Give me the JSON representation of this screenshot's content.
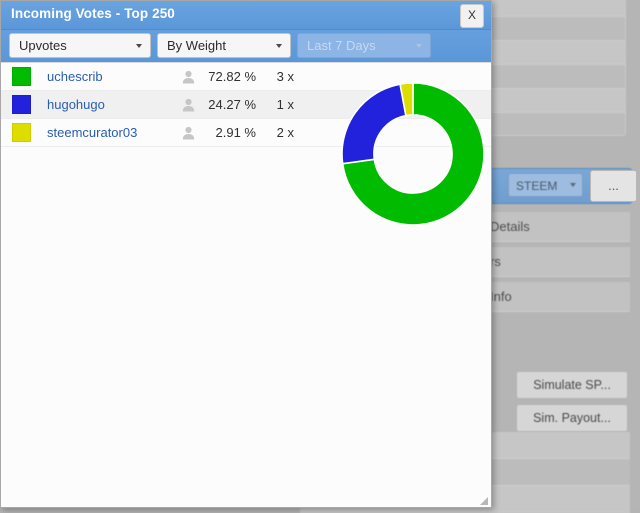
{
  "background": {
    "toolbar": {
      "steem_select_label": "STEEM",
      "more_button_label": "..."
    },
    "menu_items": [
      {
        "label": "Details"
      },
      {
        "label": "rs"
      },
      {
        "label": "Info"
      }
    ],
    "buttons": [
      {
        "label": "Simulate SP..."
      },
      {
        "label": "Sim. Payout..."
      }
    ]
  },
  "dialog": {
    "title": "Incoming Votes - Top 250",
    "close_label": "X",
    "toolbar": {
      "vote_type": {
        "value": "Upvotes",
        "disabled": false
      },
      "sort_by": {
        "value": "By Weight",
        "disabled": false
      },
      "period": {
        "value": "Last 7 Days",
        "disabled": true
      }
    },
    "rows": [
      {
        "color": "#00bb00",
        "name": "uchescrib",
        "percent": "72.82 %",
        "count": "3 x"
      },
      {
        "color": "#2222dd",
        "name": "hugohugo",
        "percent": "24.27 %",
        "count": "1 x"
      },
      {
        "color": "#dddd00",
        "name": "steemcurator03",
        "percent": "2.91 %",
        "count": "2 x"
      }
    ]
  },
  "chart_data": {
    "type": "pie",
    "variant": "donut",
    "title": "Incoming Votes - Top 250",
    "categories": [
      "uchescrib",
      "hugohugo",
      "steemcurator03"
    ],
    "values": [
      72.82,
      24.27,
      2.91
    ],
    "value_labels": [
      "72.82 %",
      "24.27 %",
      "2.91 %"
    ],
    "counts": [
      3,
      1,
      2
    ],
    "count_labels": [
      "3 x",
      "1 x",
      "2 x"
    ],
    "colors": [
      "#00bb00",
      "#2222dd",
      "#dddd00"
    ],
    "unit": "%",
    "total": 100.0,
    "start_angle_deg": -90,
    "direction": "clockwise",
    "inner_radius_ratio": 0.55,
    "legend": "left-list",
    "grid": false
  }
}
